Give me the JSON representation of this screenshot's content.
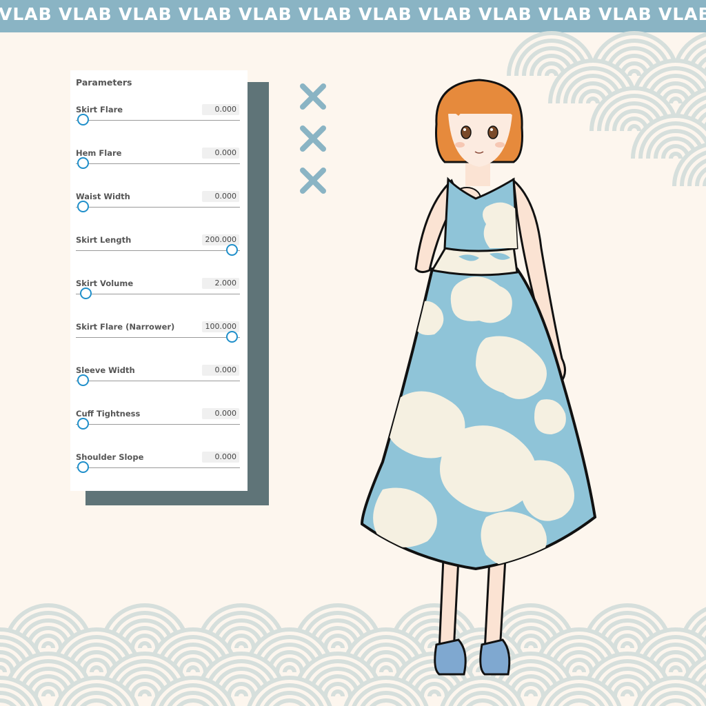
{
  "banner": {
    "word": "VLAB",
    "color": "#8ab4c4"
  },
  "panel": {
    "title": "Parameters",
    "params": [
      {
        "label": "Skirt Flare",
        "value": "0.000",
        "level": 0.0
      },
      {
        "label": "Hem Flare",
        "value": "0.000",
        "level": 0.0
      },
      {
        "label": "Waist Width",
        "value": "0.000",
        "level": 0.0
      },
      {
        "label": "Skirt Length",
        "value": "200.000",
        "level": 1.0
      },
      {
        "label": "Skirt Volume",
        "value": "2.000",
        "level": 0.02
      },
      {
        "label": "Skirt Flare (Narrower)",
        "value": "100.000",
        "level": 1.0
      },
      {
        "label": "Sleeve Width",
        "value": "0.000",
        "level": 0.0
      },
      {
        "label": "Cuff Tightness",
        "value": "0.000",
        "level": 0.0
      },
      {
        "label": "Shoulder Slope",
        "value": "0.000",
        "level": 0.0
      }
    ]
  },
  "close_buttons": [
    {
      "icon": "close-icon"
    },
    {
      "icon": "close-icon"
    },
    {
      "icon": "close-icon"
    }
  ],
  "colors": {
    "background": "#fdf6ee",
    "accent": "#1f8fca",
    "cross": "#8ab4c4",
    "dress_blue": "#8fc4d8",
    "dress_cream": "#f5f0e1"
  }
}
